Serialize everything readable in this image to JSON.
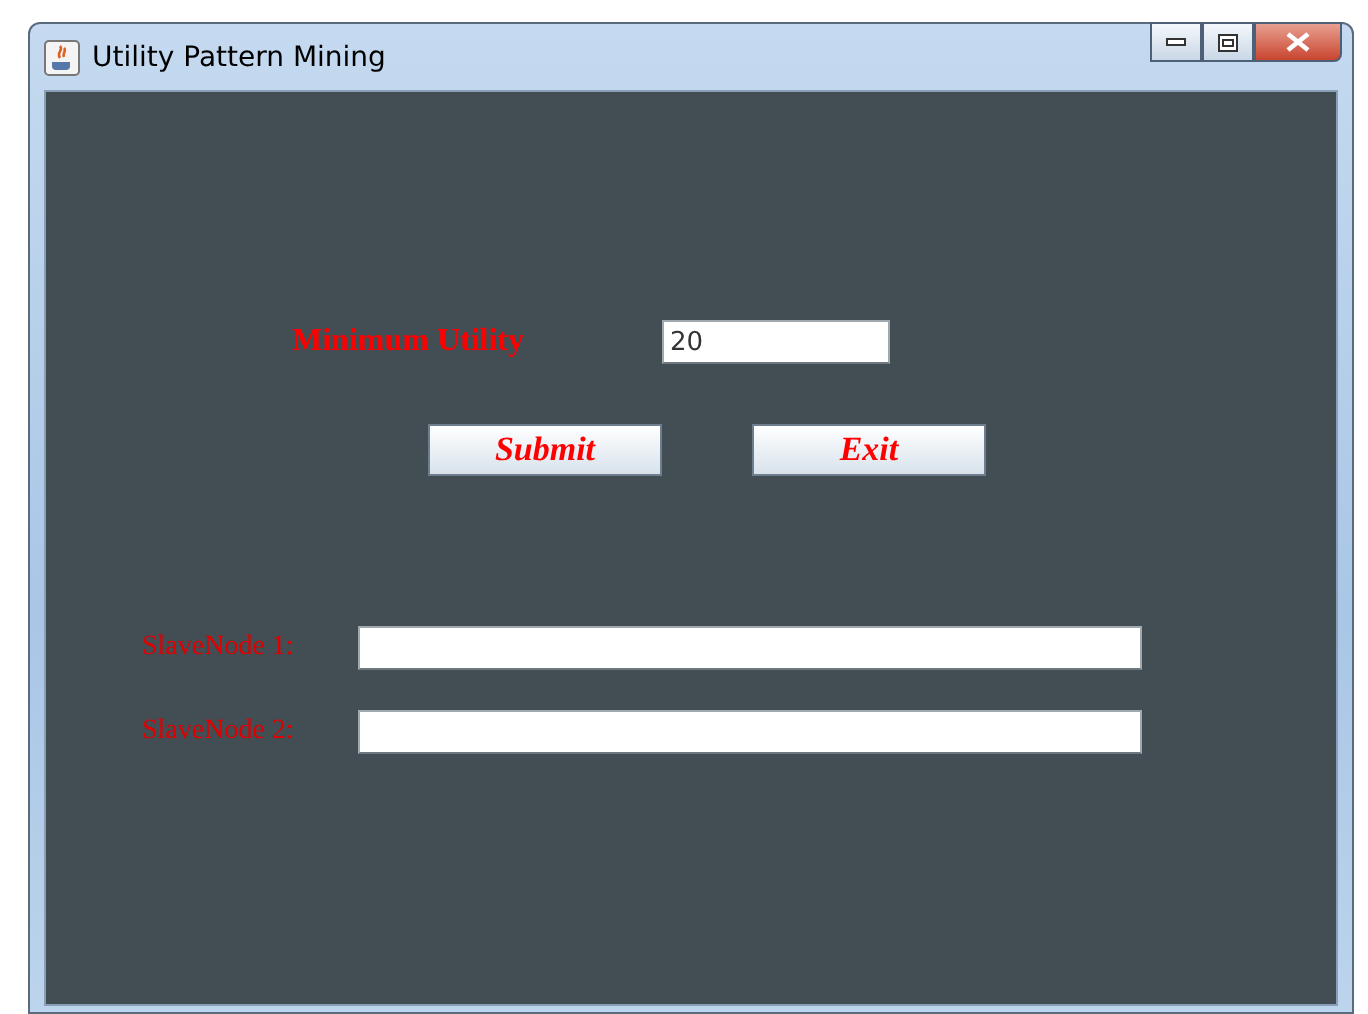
{
  "window": {
    "title": "Utility Pattern Mining"
  },
  "minimum_utility": {
    "label": "Minimum Utility",
    "value": "20"
  },
  "buttons": [
    {
      "label": "Submit"
    },
    {
      "label": "Exit"
    }
  ],
  "slave_nodes": [
    {
      "label": "SlaveNode 1:"
    },
    {
      "label": "SlaveNode 2:"
    }
  ]
}
